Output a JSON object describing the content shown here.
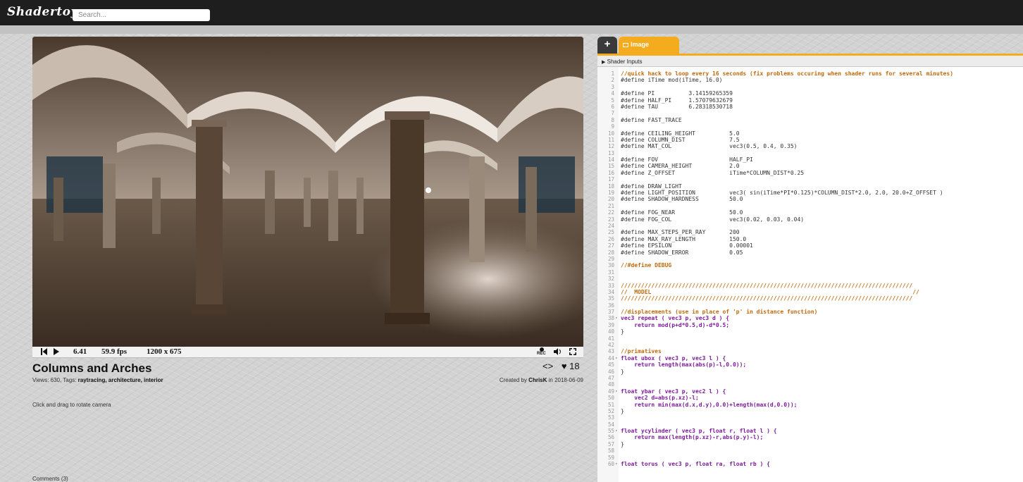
{
  "header": {
    "logo": "Shadertoy",
    "search_placeholder": "Search..."
  },
  "player": {
    "time": "6.41",
    "fps": "59.9 fps",
    "resolution": "1200 x 675",
    "rec_label": "REC"
  },
  "shader": {
    "title": "Columns and Arches",
    "views_label": "Views: 630, Tags: ",
    "tags": "raytracing, architecture, interior",
    "created_prefix": "Created by ",
    "author": "ChrisK",
    "created_suffix": " in 2018-06-09",
    "likes": "18",
    "description": "Click and drag to rotate camera",
    "comments": "Comments (3)"
  },
  "editor": {
    "add_tab": "+",
    "tab_label": "Image",
    "shader_inputs": "Shader Inputs",
    "lines": [
      {
        "n": "1",
        "t": "//quick hack to loop every 16 seconds (fix problems occuring when shader runs for several minutes)",
        "c": "comment"
      },
      {
        "n": "2",
        "t": "#define iTime mod(iTime, 16.0)",
        "c": "def"
      },
      {
        "n": "3",
        "t": "",
        "c": "def"
      },
      {
        "n": "4",
        "t": "#define PI          3.14159265359",
        "c": "def"
      },
      {
        "n": "5",
        "t": "#define HALF_PI     1.57079632679",
        "c": "def"
      },
      {
        "n": "6",
        "t": "#define TAU         6.28318530718",
        "c": "def"
      },
      {
        "n": "7",
        "t": "",
        "c": "def"
      },
      {
        "n": "8",
        "t": "#define FAST_TRACE",
        "c": "def"
      },
      {
        "n": "9",
        "t": "",
        "c": "def"
      },
      {
        "n": "10",
        "t": "#define CEILING_HEIGHT          5.0",
        "c": "def"
      },
      {
        "n": "11",
        "t": "#define COLUMN_DIST             7.5",
        "c": "def"
      },
      {
        "n": "12",
        "t": "#define MAT_COL                 vec3(0.5, 0.4, 0.35)",
        "c": "def"
      },
      {
        "n": "13",
        "t": "",
        "c": "def"
      },
      {
        "n": "14",
        "t": "#define FOV                     HALF_PI",
        "c": "def"
      },
      {
        "n": "15",
        "t": "#define CAMERA_HEIGHT           2.0",
        "c": "def"
      },
      {
        "n": "16",
        "t": "#define Z_OFFSET                iTime*COLUMN_DIST*0.25",
        "c": "def"
      },
      {
        "n": "17",
        "t": "",
        "c": "def"
      },
      {
        "n": "18",
        "t": "#define DRAW_LIGHT",
        "c": "def"
      },
      {
        "n": "19",
        "t": "#define LIGHT_POSITION          vec3( sin(iTime*PI*0.125)*COLUMN_DIST*2.0, 2.0, 20.0+Z_OFFSET )",
        "c": "def"
      },
      {
        "n": "20",
        "t": "#define SHADOW_HARDNESS         50.0",
        "c": "def"
      },
      {
        "n": "21",
        "t": "",
        "c": "def"
      },
      {
        "n": "22",
        "t": "#define FOG_NEAR                50.0",
        "c": "def"
      },
      {
        "n": "23",
        "t": "#define FOG_COL                 vec3(0.02, 0.03, 0.04)",
        "c": "def"
      },
      {
        "n": "24",
        "t": "",
        "c": "def"
      },
      {
        "n": "25",
        "t": "#define MAX_STEPS_PER_RAY       200",
        "c": "def"
      },
      {
        "n": "26",
        "t": "#define MAX_RAY_LENGTH          150.0",
        "c": "def"
      },
      {
        "n": "27",
        "t": "#define EPSILON                 0.00001",
        "c": "def"
      },
      {
        "n": "28",
        "t": "#define SHADOW_ERROR            0.05",
        "c": "def"
      },
      {
        "n": "29",
        "t": "",
        "c": "def"
      },
      {
        "n": "30",
        "t": "//#define DEBUG",
        "c": "comment"
      },
      {
        "n": "31",
        "t": "",
        "c": "def"
      },
      {
        "n": "32",
        "t": "",
        "c": "def"
      },
      {
        "n": "33",
        "t": "//////////////////////////////////////////////////////////////////////////////////////",
        "c": "comment"
      },
      {
        "n": "34",
        "t": "//  MODEL                                                                             //",
        "c": "comment"
      },
      {
        "n": "35",
        "t": "//////////////////////////////////////////////////////////////////////////////////////",
        "c": "comment"
      },
      {
        "n": "36",
        "t": "",
        "c": "def"
      },
      {
        "n": "37",
        "t": "//displacements (use in place of 'p' in distance function)",
        "c": "comment"
      },
      {
        "n": "38",
        "t": "vec3 repeat ( vec3 p, vec3 d ) {",
        "c": "kw",
        "f": "▾"
      },
      {
        "n": "39",
        "t": "    return mod(p+d*0.5,d)-d*0.5;",
        "c": "kw"
      },
      {
        "n": "40",
        "t": "}",
        "c": "def"
      },
      {
        "n": "41",
        "t": "",
        "c": "def"
      },
      {
        "n": "42",
        "t": "",
        "c": "def"
      },
      {
        "n": "43",
        "t": "//primatives",
        "c": "comment"
      },
      {
        "n": "44",
        "t": "float ubox ( vec3 p, vec3 l ) {",
        "c": "kw",
        "f": "▾"
      },
      {
        "n": "45",
        "t": "    return length(max(abs(p)-l,0.0));",
        "c": "kw"
      },
      {
        "n": "46",
        "t": "}",
        "c": "def"
      },
      {
        "n": "47",
        "t": "",
        "c": "def"
      },
      {
        "n": "48",
        "t": "",
        "c": "def"
      },
      {
        "n": "49",
        "t": "float ybar ( vec3 p, vec2 l ) {",
        "c": "kw",
        "f": "▾"
      },
      {
        "n": "50",
        "t": "    vec2 d=abs(p.xz)-l;",
        "c": "kw"
      },
      {
        "n": "51",
        "t": "    return min(max(d.x,d.y),0.0)+length(max(d,0.0));",
        "c": "kw"
      },
      {
        "n": "52",
        "t": "}",
        "c": "def"
      },
      {
        "n": "53",
        "t": "",
        "c": "def"
      },
      {
        "n": "54",
        "t": "",
        "c": "def"
      },
      {
        "n": "55",
        "t": "float ycylinder ( vec3 p, float r, float l ) {",
        "c": "kw",
        "f": "▾"
      },
      {
        "n": "56",
        "t": "    return max(length(p.xz)-r,abs(p.y)-l);",
        "c": "kw"
      },
      {
        "n": "57",
        "t": "}",
        "c": "def"
      },
      {
        "n": "58",
        "t": "",
        "c": "def"
      },
      {
        "n": "59",
        "t": "",
        "c": "def"
      },
      {
        "n": "60",
        "t": "float torus ( vec3 p, float ra, float rb ) {",
        "c": "kw",
        "f": "▾"
      }
    ]
  }
}
